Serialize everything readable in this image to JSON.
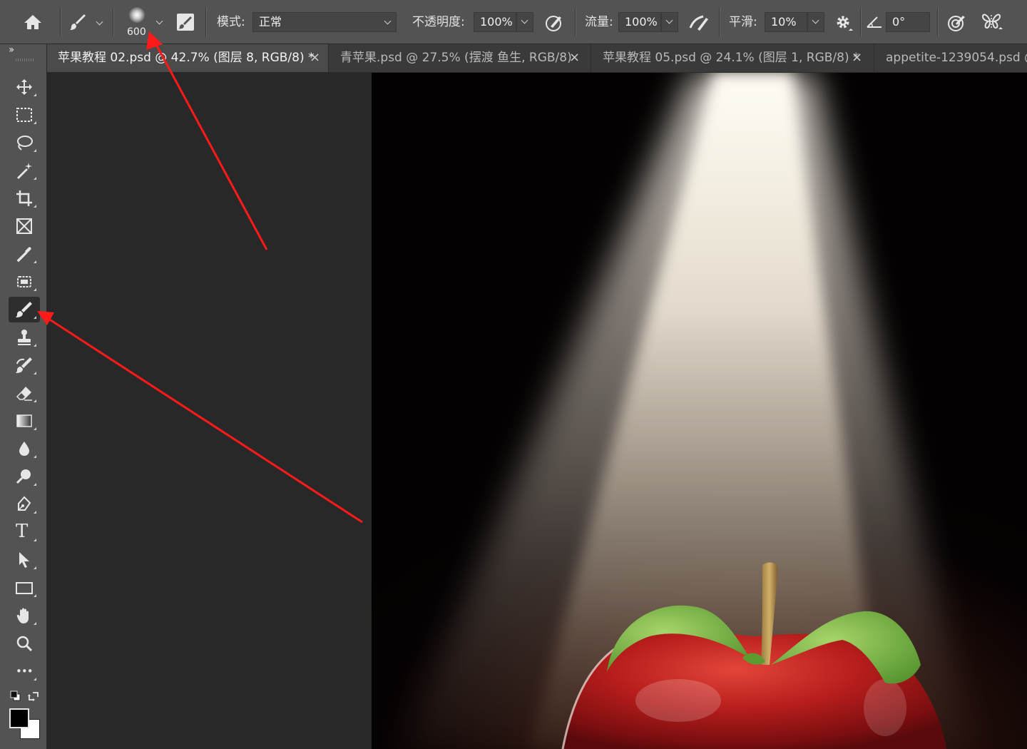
{
  "options_bar": {
    "brush_size": "600",
    "mode_label": "模式:",
    "mode_value": "正常",
    "opacity_label": "不透明度:",
    "opacity_value": "100%",
    "flow_label": "流量:",
    "flow_value": "100%",
    "smoothing_label": "平滑:",
    "smoothing_value": "10%",
    "angle_value": "0°"
  },
  "tabs": [
    {
      "label": "苹果教程 02.psd @ 42.7% (图层 8, RGB/8) *",
      "active": true
    },
    {
      "label": "青苹果.psd @ 27.5% (摆渡 鱼生, RGB/8)",
      "active": false
    },
    {
      "label": "苹果教程 05.psd @ 24.1% (图层 1, RGB/8) *",
      "active": false
    },
    {
      "label": "appetite-1239054.psd @",
      "active": false
    }
  ],
  "tab_close_glyph": "×",
  "toolbar": {
    "expand_glyph": "››",
    "tools": [
      "move",
      "marquee",
      "lasso",
      "magic-wand",
      "crop",
      "frame",
      "eyedropper",
      "healing",
      "brush",
      "clone-stamp",
      "history-brush",
      "eraser",
      "gradient",
      "blur",
      "dodge",
      "pen",
      "type",
      "path-selection",
      "rectangle",
      "hand",
      "zoom",
      "more"
    ],
    "active_tool": "brush",
    "type_glyph": "T",
    "more_glyph": "•••",
    "foreground_color": "#000000",
    "background_color": "#ffffff"
  },
  "colors": {
    "annotation_arrow": "#ff1a1a",
    "panel": "#535353",
    "workspace": "#282828"
  }
}
